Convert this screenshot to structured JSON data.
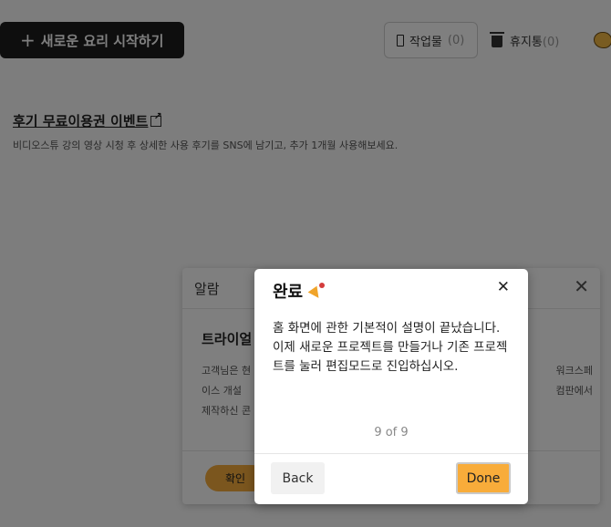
{
  "header": {
    "new_project_label": "새로운 요리 시작하기",
    "works_label": "작업물",
    "works_count": "(0)",
    "trash_label": "휴지통",
    "trash_count": "(0)"
  },
  "event": {
    "title": "후기 무료이용권 이벤트",
    "description": "비디오스튜 강의 영상 시청 후 상세한 사용 후기를 SNS에 남기고, 추가 1개월 사용해보세요."
  },
  "alert": {
    "title": "알람",
    "heading": "트라이얼",
    "body_left": "고객님은 현\n이스 개설 \n제작하신 콘",
    "body_right": "워크스페\n컴판에서",
    "ok_label": "확인"
  },
  "tour": {
    "title": "완료",
    "text": "홈 화면에 관한 기본적이 설명이 끝났습니다. 이제 새로운 프로젝트를 만들거나 기존 프로젝트를 눌러 편집모드로 진입하십시오.",
    "progress": "9 of 9",
    "back_label": "Back",
    "done_label": "Done"
  },
  "colors": {
    "accent": "#f8ac3a",
    "dark_button": "#1c1c1c"
  }
}
